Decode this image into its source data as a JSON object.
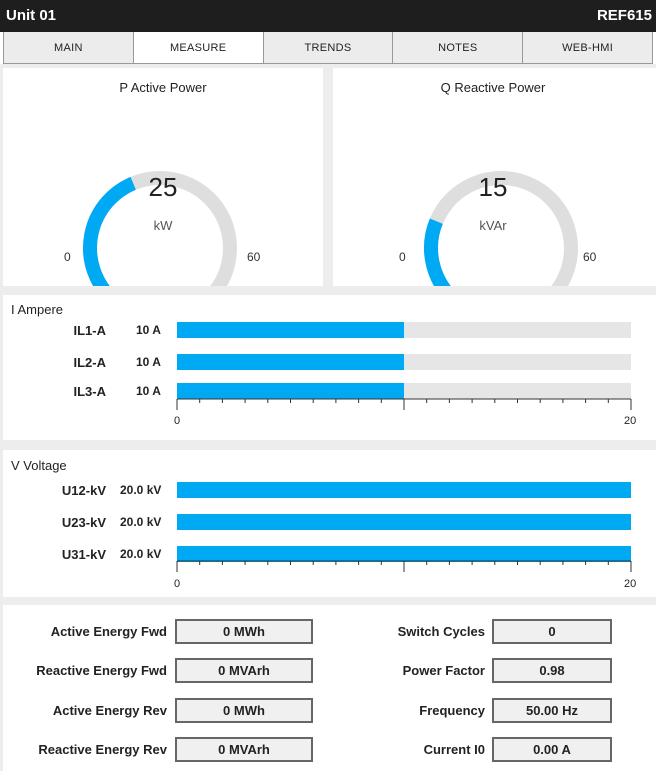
{
  "header": {
    "title": "Unit 01",
    "device": "REF615"
  },
  "tabs": [
    {
      "label": "MAIN",
      "active": false
    },
    {
      "label": "MEASURE",
      "active": true
    },
    {
      "label": "TRENDS",
      "active": false
    },
    {
      "label": "NOTES",
      "active": false
    },
    {
      "label": "WEB-HMI",
      "active": false
    }
  ],
  "gauges": [
    {
      "title": "P Active Power",
      "value": "25",
      "unit": "kW",
      "min": "0",
      "max": "60",
      "value_num": 25,
      "max_num": 60
    },
    {
      "title": "Q Reactive Power",
      "value": "15",
      "unit": "kVAr",
      "min": "0",
      "max": "60",
      "value_num": 15,
      "max_num": 60
    }
  ],
  "current": {
    "title": "I Ampere",
    "rows": [
      {
        "label": "IL1-A",
        "value": "10 A",
        "value_num": 10
      },
      {
        "label": "IL2-A",
        "value": "10 A",
        "value_num": 10
      },
      {
        "label": "IL3-A",
        "value": "10 A",
        "value_num": 10
      }
    ],
    "axis_min": "0",
    "axis_max": "20",
    "max_num": 20
  },
  "voltage": {
    "title": "V Voltage",
    "rows": [
      {
        "label": "U12-kV",
        "value": "20.0 kV",
        "value_num": 20.0
      },
      {
        "label": "U23-kV",
        "value": "20.0 kV",
        "value_num": 20.0
      },
      {
        "label": "U31-kV",
        "value": "20.0 kV",
        "value_num": 20.0
      }
    ],
    "axis_min": "0",
    "axis_max": "20",
    "max_num": 20
  },
  "stats_left": [
    {
      "label": "Active Energy Fwd",
      "value": "0 MWh"
    },
    {
      "label": "Reactive Energy Fwd",
      "value": "0 MVArh"
    },
    {
      "label": "Active Energy Rev",
      "value": "0 MWh"
    },
    {
      "label": "Reactive Energy Rev",
      "value": "0 MVArh"
    }
  ],
  "stats_right": [
    {
      "label": "Switch Cycles",
      "value": "0"
    },
    {
      "label": "Power Factor",
      "value": "0.98"
    },
    {
      "label": "Frequency",
      "value": "50.00 Hz"
    },
    {
      "label": "Current I0",
      "value": "0.00 A"
    }
  ],
  "colors": {
    "accent": "#00a9f4",
    "track": "#dedede",
    "header": "#1e1e1e"
  }
}
